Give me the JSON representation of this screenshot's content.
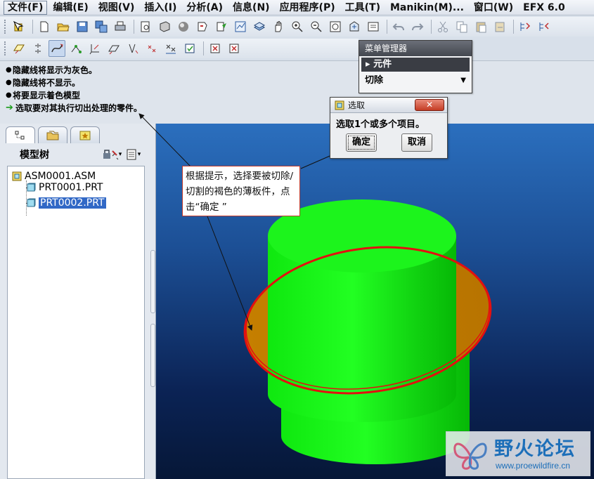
{
  "menubar": {
    "items": [
      "文件(F)",
      "编辑(E)",
      "视图(V)",
      "插入(I)",
      "分析(A)",
      "信息(N)",
      "应用程序(P)",
      "工具(T)",
      "Manikin(M)...",
      "窗口(W)",
      "EFX 6.0"
    ]
  },
  "toolbar1": {
    "icons": [
      "select-box-icon",
      "new-file-icon",
      "open-folder-icon",
      "save-icon",
      "save-copy-icon",
      "print-icon",
      "print-preview-icon",
      "shade-icon",
      "sphere-display-icon",
      "repaint-icon",
      "regenerate-icon",
      "view-manager-icon",
      "layers-icon",
      "pan-hand-icon",
      "zoom-in-icon",
      "zoom-out-icon",
      "refit-icon",
      "orient-icon",
      "saved-views-icon",
      "undo-icon",
      "redo-icon",
      "cut-icon",
      "copy-icon",
      "paste-icon",
      "paste-special-icon",
      "model-tree-settings-icon",
      "model-tree-columns-icon"
    ]
  },
  "toolbar2": {
    "icons": [
      "datum-plane-icon",
      "datum-axis-icon",
      "datum-curve-icon",
      "datum-point-icon",
      "datum-csys-icon",
      "datum-plane-display-icon",
      "datum-axis-display-icon",
      "point-display-icon",
      "csys-display-icon",
      "spin-center-icon",
      "annotation-display-icon",
      "close-window-icon"
    ]
  },
  "messages": [
    {
      "type": "bullet",
      "text": "隐藏线将显示为灰色。"
    },
    {
      "type": "bullet",
      "text": "隐藏线将不显示。"
    },
    {
      "type": "bullet",
      "text": "将要显示着色模型"
    },
    {
      "type": "arrow",
      "text": "选取要对其执行切出处理的零件。"
    }
  ],
  "navigator": {
    "tabs": [
      "model-tree-tab",
      "folder-browser-tab",
      "favorites-tab"
    ],
    "title": "模型树",
    "tools": [
      "settings-icon",
      "show-icon"
    ],
    "tree": {
      "root": "ASM0001.ASM",
      "children": [
        {
          "label": "PRT0001.PRT",
          "selected": false
        },
        {
          "label": "PRT0002.PRT",
          "selected": true
        }
      ]
    }
  },
  "menu_manager": {
    "title": "菜单管理器",
    "item_component": "元件",
    "item_cut": "切除"
  },
  "select_dialog": {
    "title": "选取",
    "prompt": "选取1个或多个项目。",
    "ok": "确定",
    "cancel": "取消"
  },
  "callout": {
    "text": "根据提示，选择要被切除/切割的褐色的薄板件，点击“确定 ”"
  },
  "model": {
    "cylinder_color": "#00ee00",
    "plate_color": "#c47e00",
    "plate_edge_color": "#e00000"
  },
  "watermark": {
    "title": "野火论坛",
    "url": "www.proewildfire.cn"
  }
}
